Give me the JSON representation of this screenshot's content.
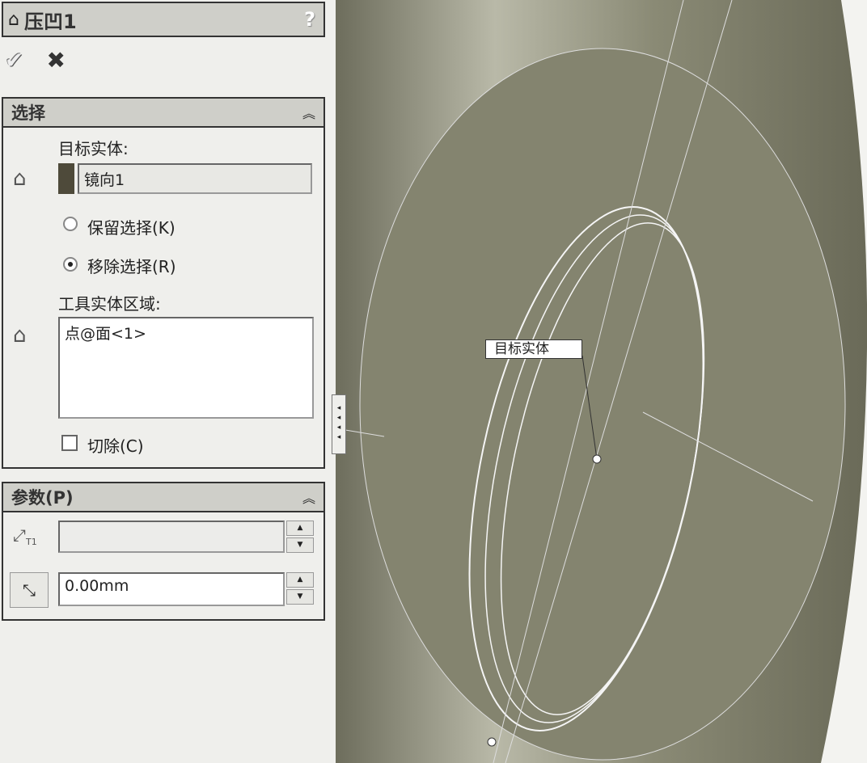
{
  "feature": {
    "title": "压凹1",
    "help": "?",
    "ok_icon": "check-icon",
    "cancel_icon": "close-icon"
  },
  "selection": {
    "title": "选择",
    "target_label": "目标实体:",
    "target_value": "镜向1",
    "keep": "保留选择(K)",
    "remove": "移除选择(R)",
    "selected_option": "remove",
    "tool_label": "工具实体区域:",
    "tool_value": "点@面<1>",
    "cut": "切除(C)",
    "cut_checked": false
  },
  "params": {
    "title": "参数(P)",
    "thickness_value": "",
    "clearance_value": "0.00mm"
  },
  "viewport": {
    "callout": "目标实体",
    "model_color": "#86866f"
  }
}
